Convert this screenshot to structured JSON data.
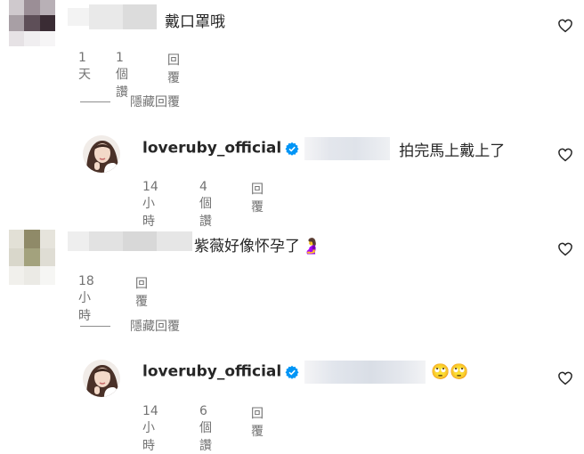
{
  "comments": [
    {
      "text": "戴口罩哦",
      "age": "1 天",
      "likes": "1個讚",
      "reply_label": "回覆",
      "hide_replies_label": "隱藏回覆",
      "reply": {
        "username": "loveruby_official",
        "text": "拍完馬上戴上了",
        "age": "14小時",
        "likes": "4個讚",
        "reply_label": "回覆"
      }
    },
    {
      "text": "紫薇好像怀孕了",
      "emoji": "🤰",
      "age": "18小時",
      "reply_label": "回覆",
      "hide_replies_label": "隱藏回覆",
      "reply": {
        "username": "loveruby_official",
        "emoji": "🙄🙄",
        "age": "14小時",
        "likes": "6個讚",
        "reply_label": "回覆"
      }
    }
  ],
  "icons": {
    "like": "heart-outline-icon",
    "verified": "verified-badge-icon"
  },
  "colors": {
    "text": "#262626",
    "secondary": "#737373",
    "verified": "#0095f6"
  }
}
